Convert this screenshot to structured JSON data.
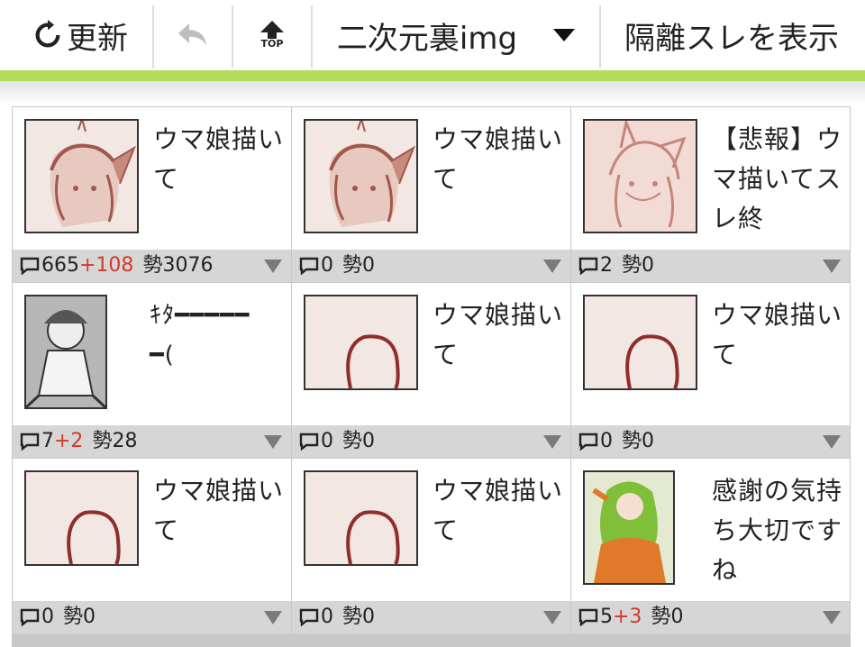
{
  "toolbar": {
    "refresh_label": "更新",
    "board_name": "二次元裏img",
    "hidden_threads_label": "隔離スレを表示",
    "top_icon_text": "TOP"
  },
  "threads": [
    {
      "title": "ウマ娘描いて",
      "replies": "665",
      "new": "+108",
      "ikioi_label": "勢",
      "ikioi": "3076",
      "thumb": "pink-sketch-horse-girl-icon"
    },
    {
      "title": "ウマ娘描いて",
      "replies": "0",
      "new": "",
      "ikioi_label": "勢",
      "ikioi": "0",
      "thumb": "pink-sketch-horse-girl-icon"
    },
    {
      "title": "【悲報】ウマ描いてスレ終",
      "replies": "2",
      "new": "",
      "ikioi_label": "勢",
      "ikioi": "0",
      "thumb": "pink-sketch-horse-girl-icon"
    },
    {
      "title": "ｷﾀ━━━━━━(",
      "replies": "7",
      "new": "+2",
      "ikioi_label": "勢",
      "ikioi": "28",
      "thumb": "grayscale-character-icon"
    },
    {
      "title": "ウマ娘描いて",
      "replies": "0",
      "new": "",
      "ikioi_label": "勢",
      "ikioi": "0",
      "thumb": "pink-outline-sketch-icon"
    },
    {
      "title": "ウマ娘描いて",
      "replies": "0",
      "new": "",
      "ikioi_label": "勢",
      "ikioi": "0",
      "thumb": "pink-outline-sketch-icon"
    },
    {
      "title": "ウマ娘描いて",
      "replies": "0",
      "new": "",
      "ikioi_label": "勢",
      "ikioi": "0",
      "thumb": "pink-outline-sketch-icon"
    },
    {
      "title": "ウマ娘描いて",
      "replies": "0",
      "new": "",
      "ikioi_label": "勢",
      "ikioi": "0",
      "thumb": "pink-outline-sketch-icon"
    },
    {
      "title": "感謝の気持ち大切ですね",
      "replies": "5",
      "new": "+3",
      "ikioi_label": "勢",
      "ikioi": "0",
      "thumb": "green-hair-girl-orange-sweater-icon"
    }
  ],
  "colors": {
    "accent_bar": "#b5db5a",
    "new_count": "#d03a2a",
    "meta_bg": "#d6d6d6"
  }
}
